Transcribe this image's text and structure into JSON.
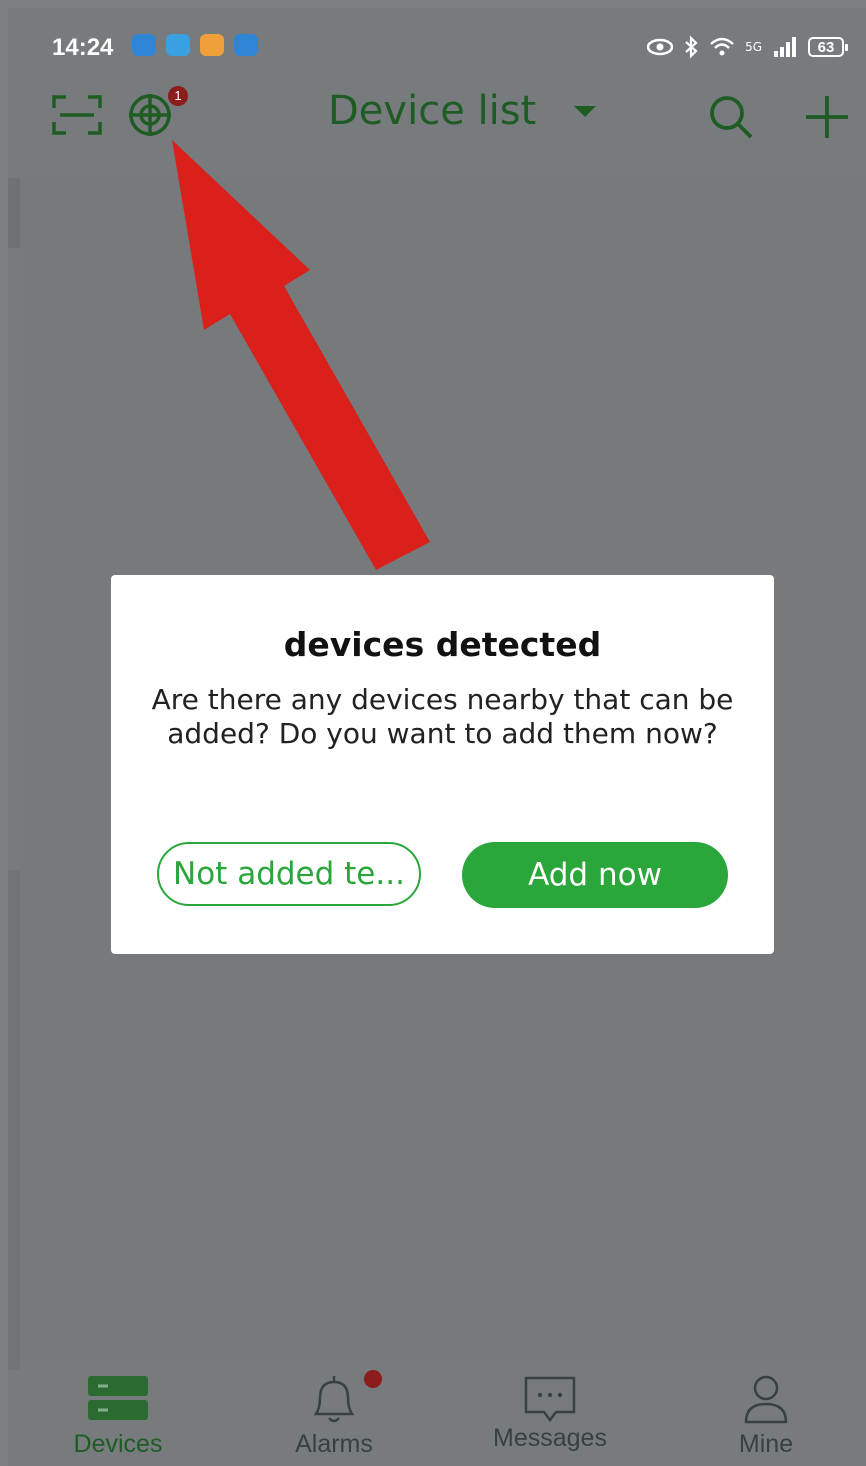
{
  "status_bar": {
    "time": "14:24",
    "network": "5G",
    "battery": "63"
  },
  "header": {
    "title": "Device list",
    "scan_badge_count": "1"
  },
  "dialog": {
    "title": "devices detected",
    "message": "Are there any devices nearby that can be added? Do you want to add them now?",
    "secondary_button": "Not added te...",
    "primary_button": "Add now"
  },
  "bottom_nav": {
    "items": [
      {
        "label": "Devices",
        "icon": "devices-icon",
        "active": true
      },
      {
        "label": "Alarms",
        "icon": "bell-icon",
        "active": false
      },
      {
        "label": "Messages",
        "icon": "message-icon",
        "active": false
      },
      {
        "label": "Mine",
        "icon": "user-icon",
        "active": false
      }
    ]
  },
  "colors": {
    "accent": "#2aa63b",
    "header_green": "#1f5c24",
    "overlay": "#777b7e",
    "arrow": "#d9201a",
    "badge": "#8b1d1d"
  }
}
